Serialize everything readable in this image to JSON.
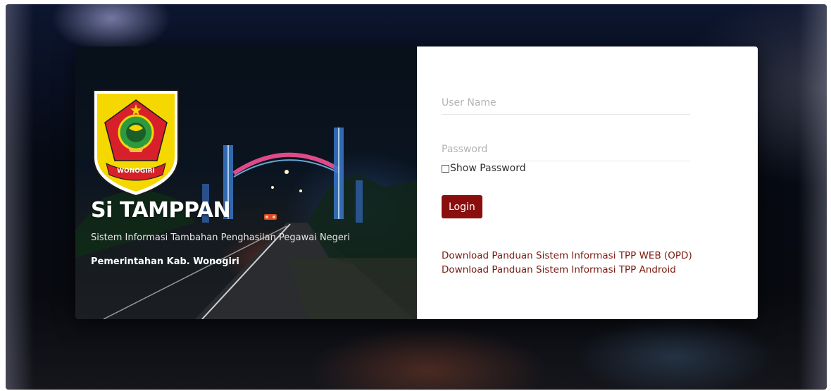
{
  "hero": {
    "logo_text": "WONOGIRI",
    "title": "Si TAMPPAN",
    "subtitle": "Sistem Informasi Tambahan Penghasilan Pegawai Negeri",
    "organization": "Pemerintahan Kab. Wonogiri"
  },
  "login_form": {
    "username_placeholder": "User Name",
    "username_value": "",
    "password_placeholder": "Password",
    "password_value": "",
    "show_password_label": "Show Password",
    "show_password_checked": false,
    "login_label": "Login"
  },
  "links": {
    "guide_web": "Download Panduan Sistem Informasi TPP WEB (OPD)",
    "guide_android": "Download Panduan Sistem Informasi TPP Android"
  },
  "colors": {
    "accent": "#8b0e0e",
    "link": "#7a1a10",
    "logo_yellow": "#f4d800",
    "logo_red": "#d8202a"
  },
  "icons": {
    "logo": "wonogiri-regency-emblem"
  }
}
